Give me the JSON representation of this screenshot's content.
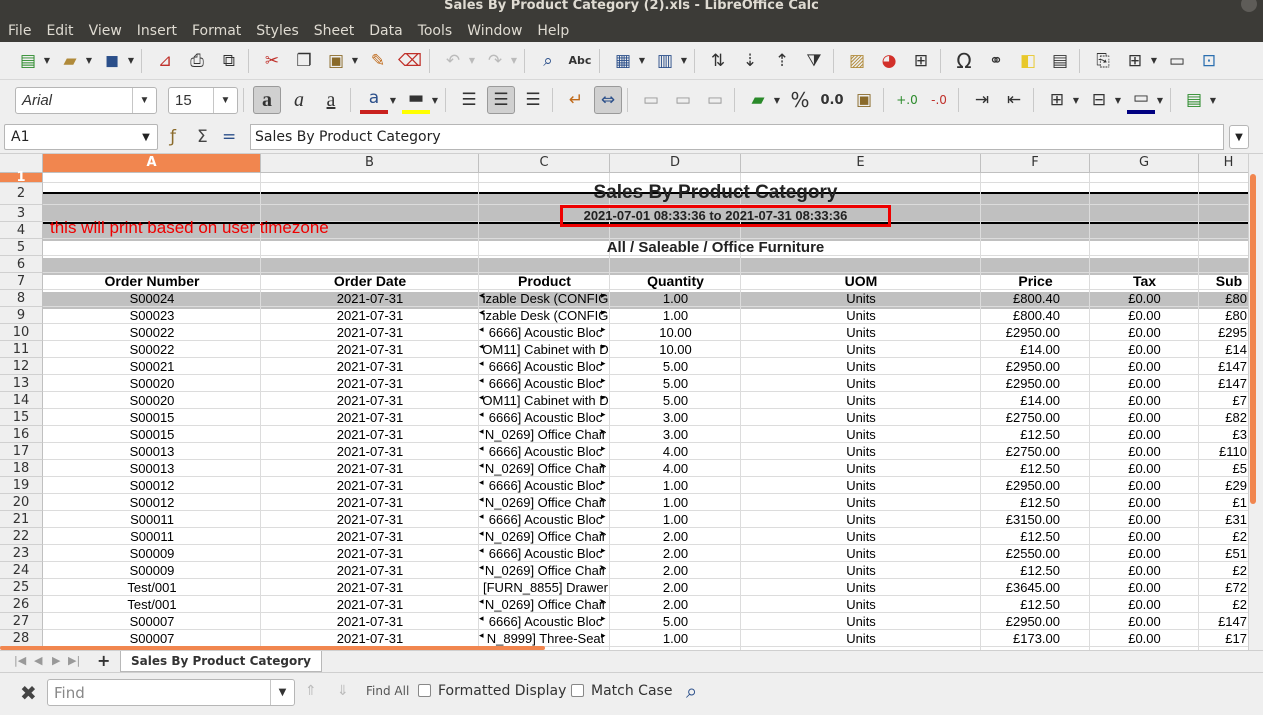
{
  "window": {
    "title": "Sales By Product Category (2).xls - LibreOffice Calc"
  },
  "menu": [
    "File",
    "Edit",
    "View",
    "Insert",
    "Format",
    "Styles",
    "Sheet",
    "Data",
    "Tools",
    "Window",
    "Help"
  ],
  "toolbar": {
    "font_name": "Arial",
    "font_size": "15",
    "percent_label": "%",
    "number_label": "0.0"
  },
  "formula_bar": {
    "name_box": "A1",
    "content": "Sales By Product Category"
  },
  "columns": [
    "A",
    "B",
    "C",
    "D",
    "E",
    "F",
    "G",
    "H"
  ],
  "rows": [
    "1",
    "2",
    "3",
    "4",
    "5",
    "6",
    "7",
    "8",
    "9",
    "10",
    "11",
    "12",
    "13",
    "14",
    "15",
    "16",
    "17",
    "18",
    "19",
    "20",
    "21",
    "22",
    "23",
    "24",
    "25",
    "26",
    "27",
    "28"
  ],
  "report": {
    "title": "Sales By Product Category",
    "date_range": "2021-07-01 08:33:36 to 2021-07-31 08:33:36",
    "timezone_note": "this will print based on user timezone",
    "category": "All / Saleable / Office Furniture",
    "headers": [
      "Order Number",
      "Order Date",
      "Product",
      "Quantity",
      "UOM",
      "Price",
      "Tax",
      "Sub"
    ],
    "rows": [
      [
        "S00024",
        "2021-07-31",
        "izable Desk (CONFIG",
        "1.00",
        "Units",
        "£800.40",
        "£0.00",
        "£80"
      ],
      [
        "S00023",
        "2021-07-31",
        "izable Desk (CONFIG",
        "1.00",
        "Units",
        "£800.40",
        "£0.00",
        "£80"
      ],
      [
        "S00022",
        "2021-07-31",
        "6666] Acoustic Bloc",
        "10.00",
        "Units",
        "£2950.00",
        "£0.00",
        "£295"
      ],
      [
        "S00022",
        "2021-07-31",
        "OM11] Cabinet with D",
        "10.00",
        "Units",
        "£14.00",
        "£0.00",
        "£14"
      ],
      [
        "S00021",
        "2021-07-31",
        "6666] Acoustic Bloc",
        "5.00",
        "Units",
        "£2950.00",
        "£0.00",
        "£147"
      ],
      [
        "S00020",
        "2021-07-31",
        "6666] Acoustic Bloc",
        "5.00",
        "Units",
        "£2950.00",
        "£0.00",
        "£147"
      ],
      [
        "S00020",
        "2021-07-31",
        "OM11] Cabinet with D",
        "5.00",
        "Units",
        "£14.00",
        "£0.00",
        "£7"
      ],
      [
        "S00015",
        "2021-07-31",
        "6666] Acoustic Bloc",
        "3.00",
        "Units",
        "£2750.00",
        "£0.00",
        "£82"
      ],
      [
        "S00015",
        "2021-07-31",
        "N_0269] Office Chair",
        "3.00",
        "Units",
        "£12.50",
        "£0.00",
        "£3"
      ],
      [
        "S00013",
        "2021-07-31",
        "6666] Acoustic Bloc",
        "4.00",
        "Units",
        "£2750.00",
        "£0.00",
        "£110"
      ],
      [
        "S00013",
        "2021-07-31",
        "N_0269] Office Chair",
        "4.00",
        "Units",
        "£12.50",
        "£0.00",
        "£5"
      ],
      [
        "S00012",
        "2021-07-31",
        "6666] Acoustic Bloc",
        "1.00",
        "Units",
        "£2950.00",
        "£0.00",
        "£29"
      ],
      [
        "S00012",
        "2021-07-31",
        "N_0269] Office Chair",
        "1.00",
        "Units",
        "£12.50",
        "£0.00",
        "£1"
      ],
      [
        "S00011",
        "2021-07-31",
        "6666] Acoustic Bloc",
        "1.00",
        "Units",
        "£3150.00",
        "£0.00",
        "£31"
      ],
      [
        "S00011",
        "2021-07-31",
        "N_0269] Office Chair",
        "2.00",
        "Units",
        "£12.50",
        "£0.00",
        "£2"
      ],
      [
        "S00009",
        "2021-07-31",
        "6666] Acoustic Bloc",
        "2.00",
        "Units",
        "£2550.00",
        "£0.00",
        "£51"
      ],
      [
        "S00009",
        "2021-07-31",
        "N_0269] Office Chair",
        "2.00",
        "Units",
        "£12.50",
        "£0.00",
        "£2"
      ],
      [
        "Test/001",
        "2021-07-31",
        "[FURN_8855] Drawer",
        "2.00",
        "Units",
        "£3645.00",
        "£0.00",
        "£72"
      ],
      [
        "Test/001",
        "2021-07-31",
        "N_0269] Office Chair",
        "2.00",
        "Units",
        "£12.50",
        "£0.00",
        "£2"
      ],
      [
        "S00007",
        "2021-07-31",
        "6666] Acoustic Bloc",
        "5.00",
        "Units",
        "£2950.00",
        "£0.00",
        "£147"
      ],
      [
        "S00007",
        "2021-07-31",
        "N_8999] Three-Seat",
        "1.00",
        "Units",
        "£173.00",
        "£0.00",
        "£17"
      ]
    ]
  },
  "sheet_tab": "Sales By Product Category",
  "find_bar": {
    "placeholder": "Find",
    "find_all": "Find All",
    "formatted_display": "Formatted Display",
    "match_case": "Match Case"
  }
}
